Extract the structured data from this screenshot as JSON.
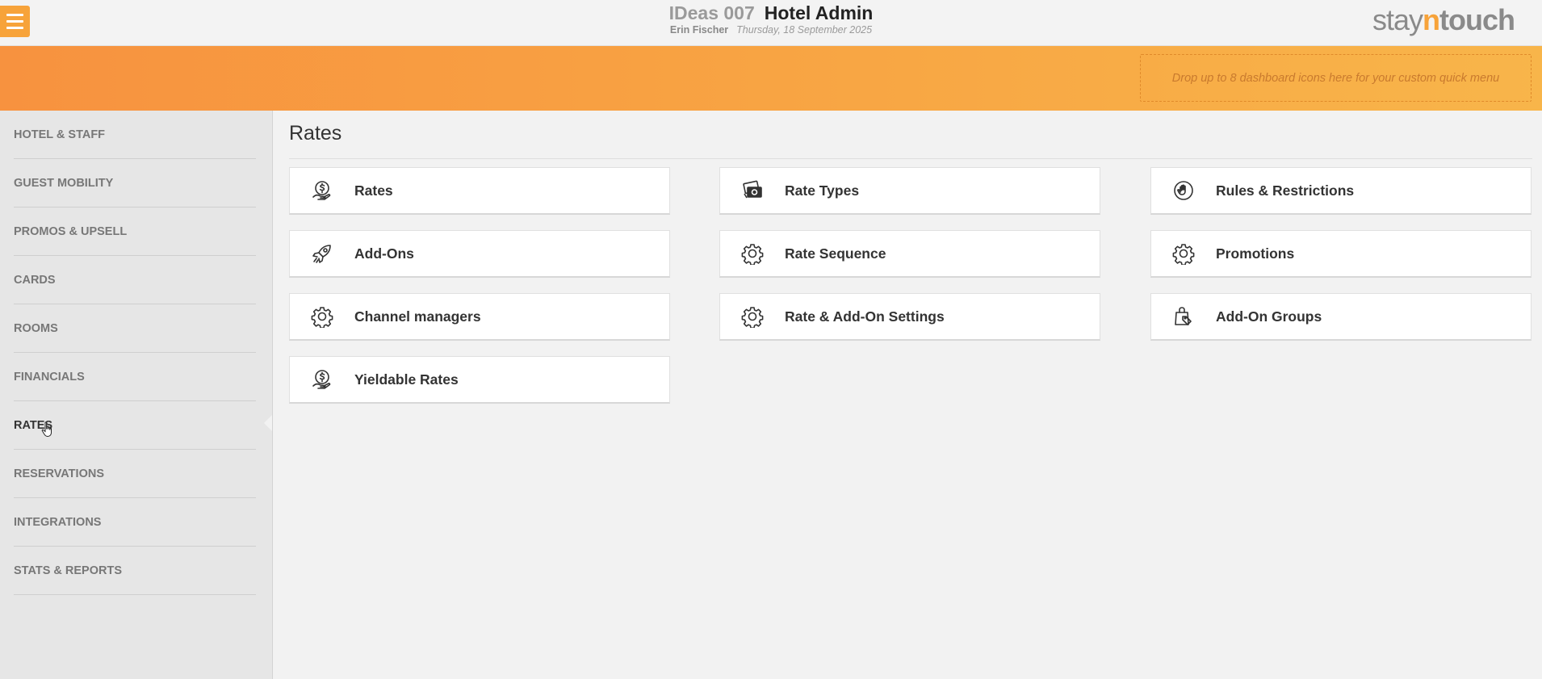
{
  "header": {
    "hotel_name": "IDeas 007",
    "app_title": "Hotel Admin",
    "user_name": "Erin Fischer",
    "date": "Thursday, 18 September 2025",
    "brand": {
      "part1": "stay",
      "part2": "n",
      "part3": "touch"
    },
    "menu_icon": "hamburger-icon"
  },
  "quick_menu": {
    "placeholder": "Drop up to 8 dashboard icons here for your custom quick menu"
  },
  "sidebar": {
    "items": [
      {
        "label": "HOTEL & STAFF"
      },
      {
        "label": "GUEST MOBILITY"
      },
      {
        "label": "PROMOS & UPSELL"
      },
      {
        "label": "CARDS"
      },
      {
        "label": "ROOMS"
      },
      {
        "label": "FINANCIALS"
      },
      {
        "label": "RATES"
      },
      {
        "label": "RESERVATIONS"
      },
      {
        "label": "INTEGRATIONS"
      },
      {
        "label": "STATS & REPORTS"
      }
    ],
    "active": "RATES"
  },
  "main": {
    "title": "Rates",
    "cards": [
      {
        "label": "Rates",
        "icon": "money-hand-icon"
      },
      {
        "label": "Rate Types",
        "icon": "money-bills-icon"
      },
      {
        "label": "Rules & Restrictions",
        "icon": "hand-stop-icon"
      },
      {
        "label": "Add-Ons",
        "icon": "rocket-icon"
      },
      {
        "label": "Rate Sequence",
        "icon": "gear-icon"
      },
      {
        "label": "Promotions",
        "icon": "gear-icon"
      },
      {
        "label": "Channel managers",
        "icon": "gear-icon"
      },
      {
        "label": "Rate & Add-On Settings",
        "icon": "gear-icon"
      },
      {
        "label": "Add-On Groups",
        "icon": "bag-icon"
      },
      {
        "label": "Yieldable Rates",
        "icon": "money-hand-icon"
      }
    ]
  },
  "colors": {
    "accent": "#f7a33a",
    "band_start": "#f7923f",
    "band_end": "#f8b54a"
  }
}
